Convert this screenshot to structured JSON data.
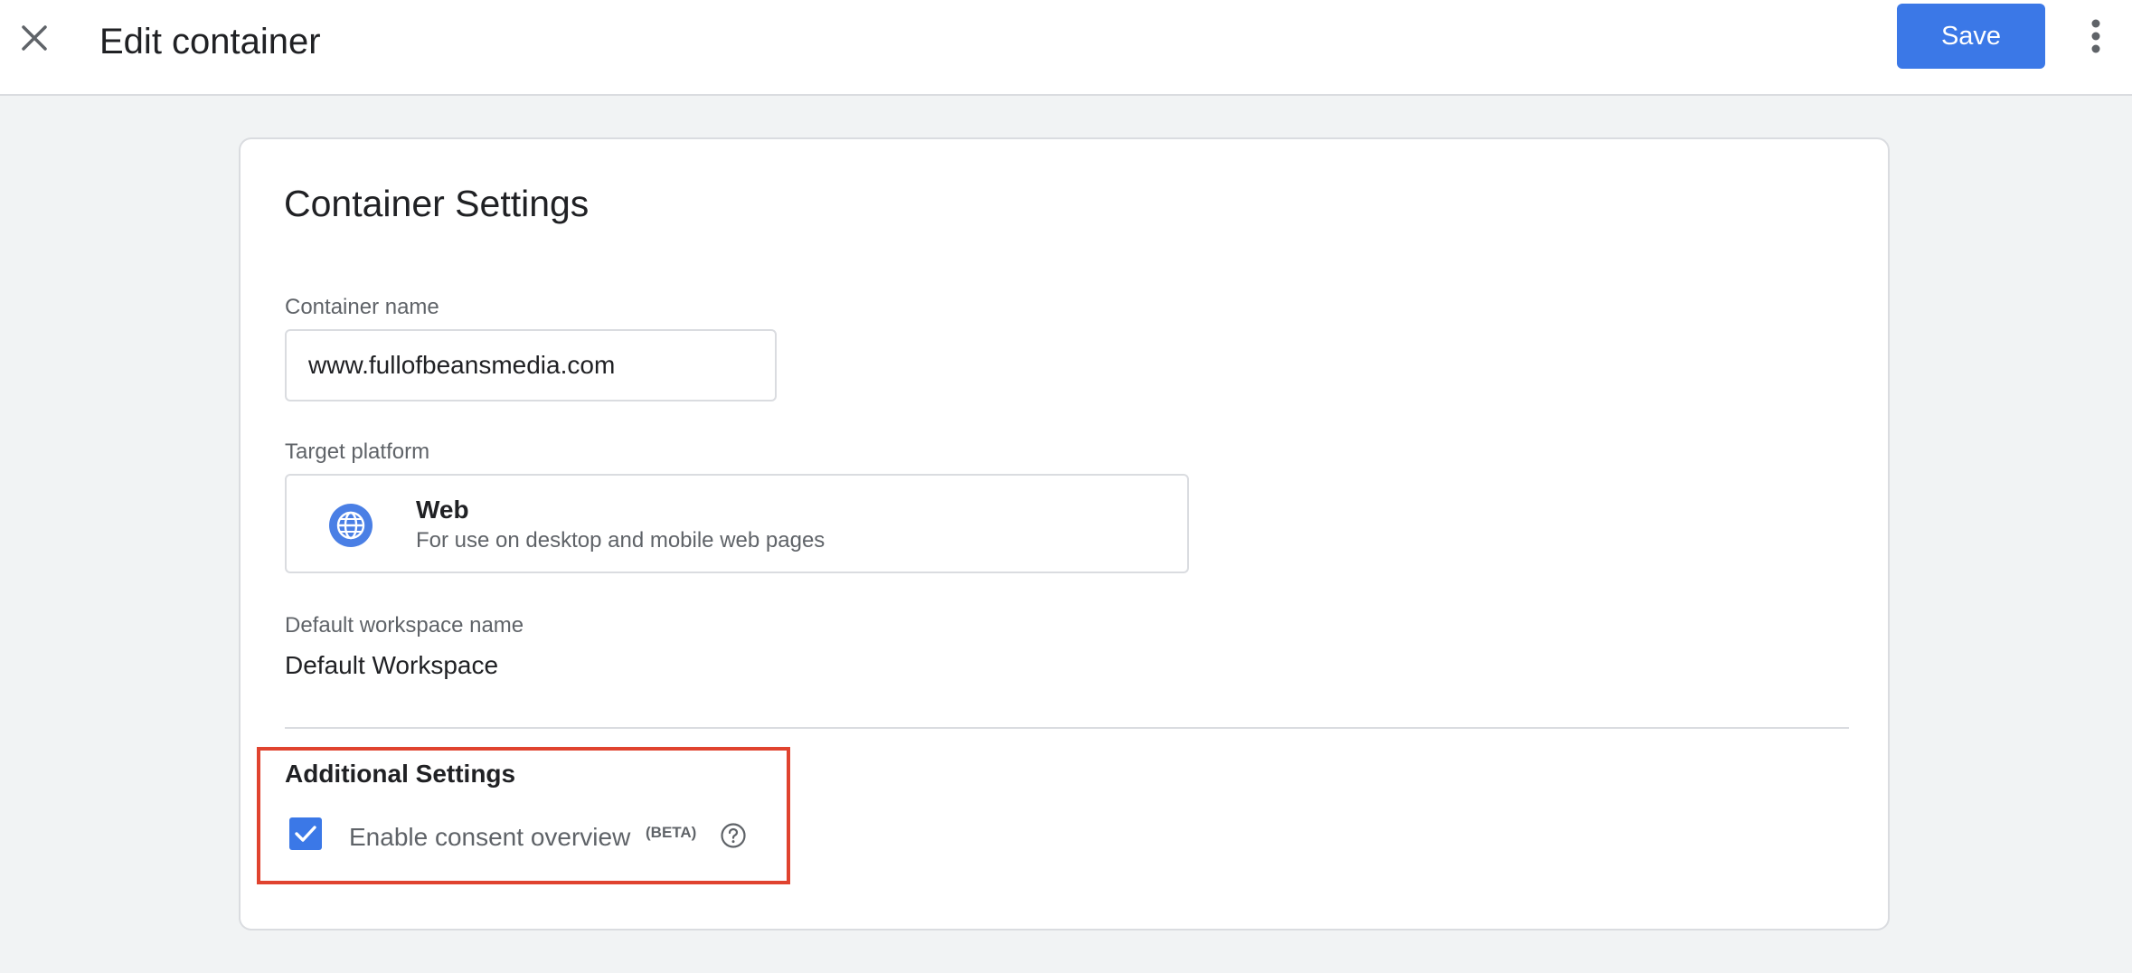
{
  "header": {
    "title": "Edit container",
    "save_label": "Save",
    "close_icon": "close-icon",
    "more_icon": "more-vert-icon"
  },
  "card": {
    "title": "Container Settings",
    "container_name": {
      "label": "Container name",
      "value": "www.fullofbeansmedia.com"
    },
    "target_platform": {
      "label": "Target platform",
      "icon": "globe-icon",
      "name": "Web",
      "description": "For use on desktop and mobile web pages"
    },
    "workspace": {
      "label": "Default workspace name",
      "value": "Default Workspace"
    },
    "additional_settings": {
      "title": "Additional Settings",
      "consent_label": "Enable consent overview",
      "beta_tag": "(BETA)",
      "checked": true,
      "help_icon": "help-circle-icon"
    }
  },
  "colors": {
    "accent": "#3b78e7",
    "highlight": "#e0432f",
    "background": "#f1f3f4"
  }
}
